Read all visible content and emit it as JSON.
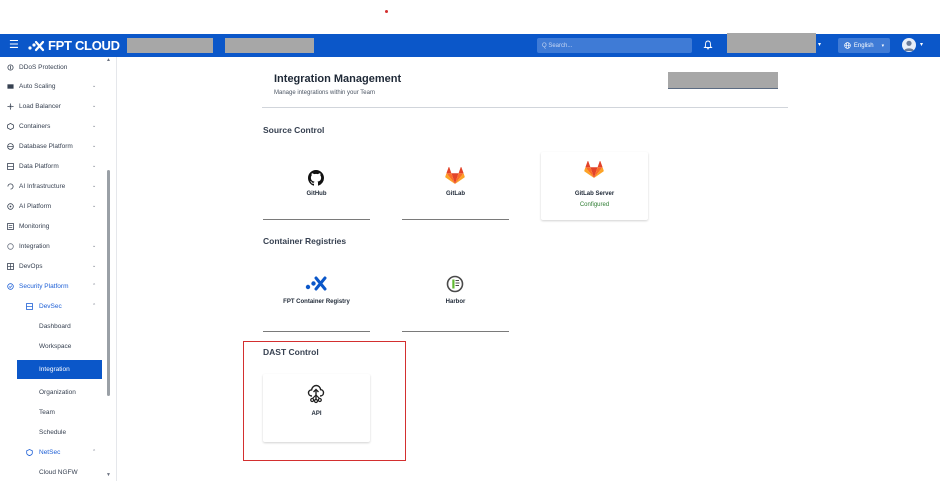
{
  "header": {
    "brand": "FPT CLOUD",
    "search_placeholder": "Q  Search...",
    "language": "English"
  },
  "sidebar": {
    "items": [
      {
        "label": "DDoS Protection",
        "icon": "shield-icon"
      },
      {
        "label": "Auto Scaling",
        "icon": "scaling-icon"
      },
      {
        "label": "Load Balancer",
        "icon": "balancer-icon"
      },
      {
        "label": "Containers",
        "icon": "container-icon"
      },
      {
        "label": "Database Platform",
        "icon": "database-icon"
      },
      {
        "label": "Data Platform",
        "icon": "data-platform-icon"
      },
      {
        "label": "AI Infrastructure",
        "icon": "ai-infra-icon"
      },
      {
        "label": "AI Platform",
        "icon": "ai-platform-icon"
      },
      {
        "label": "Monitoring",
        "icon": "monitoring-icon"
      },
      {
        "label": "Integration",
        "icon": "integration-icon"
      },
      {
        "label": "DevOps",
        "icon": "devops-icon"
      },
      {
        "label": "Security Platform",
        "icon": "security-icon"
      },
      {
        "label": "DevSec",
        "icon": "devsec-icon"
      },
      {
        "label": "Dashboard"
      },
      {
        "label": "Workspace"
      },
      {
        "label": "Integration"
      },
      {
        "label": "Organization"
      },
      {
        "label": "Team"
      },
      {
        "label": "Schedule"
      },
      {
        "label": "NetSec",
        "icon": "netsec-icon"
      },
      {
        "label": "Cloud NGFW"
      }
    ]
  },
  "main": {
    "title": "Integration Management",
    "subtitle": "Manage integrations within your Team",
    "sections": {
      "source_control": {
        "title": "Source Control",
        "cards": [
          {
            "name": "GitHub",
            "icon": "github-icon"
          },
          {
            "name": "GitLab",
            "icon": "gitlab-icon"
          },
          {
            "name": "GitLab Server",
            "status": "Configured",
            "icon": "gitlab-icon"
          }
        ]
      },
      "container_registries": {
        "title": "Container Registries",
        "cards": [
          {
            "name": "FPT Container Registry",
            "icon": "fpt-registry-icon"
          },
          {
            "name": "Harbor",
            "icon": "harbor-icon"
          }
        ]
      },
      "dast": {
        "title": "DAST Control",
        "cards": [
          {
            "name": "API",
            "icon": "api-icon"
          }
        ]
      }
    }
  },
  "colors": {
    "primary": "#0b57c9",
    "highlight_border": "#d32f2f",
    "configured": "#2e7d32",
    "gitlab_orange": "#e24329"
  }
}
